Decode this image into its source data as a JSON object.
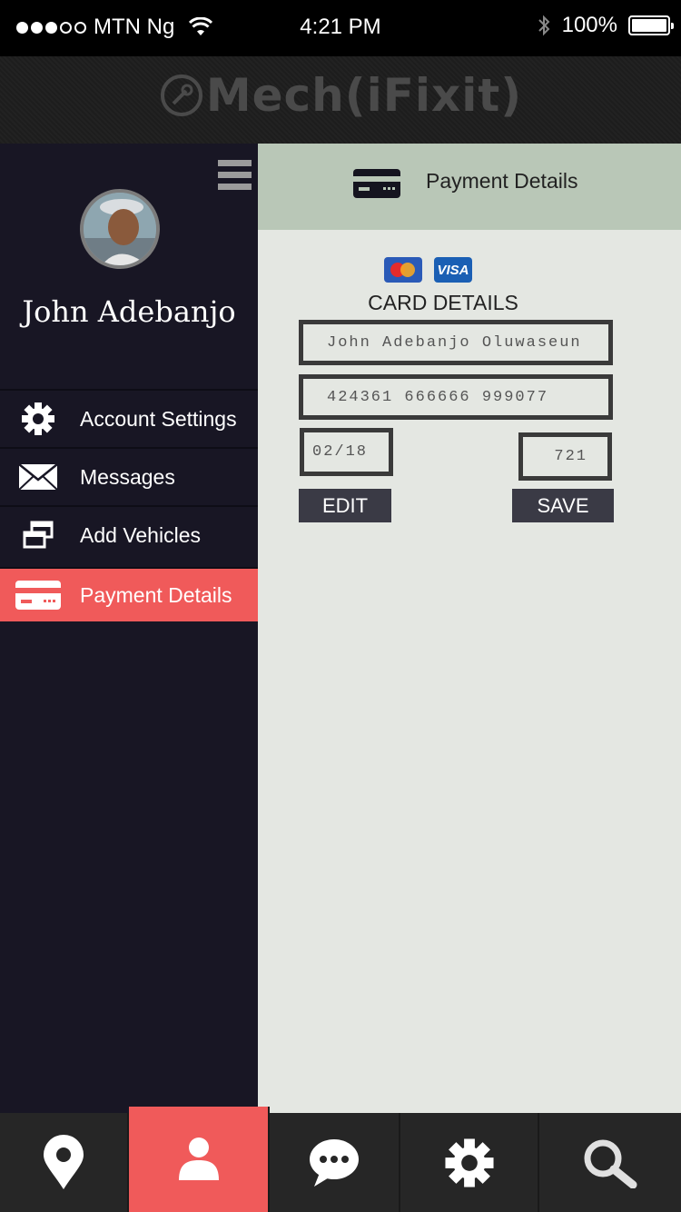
{
  "status_bar": {
    "carrier": "MTN Ng",
    "time": "4:21 PM",
    "battery": "100%"
  },
  "app": {
    "logo_text": "Mech(iFixit)"
  },
  "sidebar": {
    "user_name": "John Adebanjo",
    "items": [
      {
        "label": "Account Settings",
        "icon": "gear-icon"
      },
      {
        "label": "Messages",
        "icon": "envelope-icon"
      },
      {
        "label": "Add Vehicles",
        "icon": "windows-icon"
      },
      {
        "label": "Payment Details",
        "icon": "credit-card-icon",
        "active": true
      }
    ]
  },
  "content": {
    "title": "Payment Details",
    "card_brands": [
      "Mastercard",
      "VISA"
    ],
    "visa_text": "VISA",
    "section_title": "CARD DETAILS",
    "card_name": "John Adebanjo Oluwaseun",
    "card_number": "424361 666666 999077",
    "expiry": "02/18",
    "cvv": "721",
    "edit_label": "EDIT",
    "save_label": "SAVE"
  },
  "bottom_nav": [
    {
      "icon": "location-pin-icon"
    },
    {
      "icon": "user-icon",
      "active": true
    },
    {
      "icon": "chat-bubble-icon"
    },
    {
      "icon": "gear-icon"
    },
    {
      "icon": "search-icon"
    }
  ],
  "colors": {
    "accent": "#f05a5a",
    "sidebar": "#181624",
    "header_green": "#b9c7b7",
    "content_bg": "#e4e7e2"
  }
}
